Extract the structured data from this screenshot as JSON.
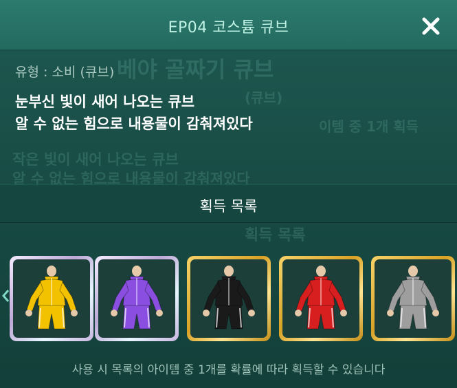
{
  "header": {
    "title": "EP04 코스튬 큐브",
    "close_icon": "close-icon"
  },
  "info": {
    "type_line": "유형 : 소비 (큐브)",
    "description": [
      "눈부신 빛이 새어 나오는 큐브",
      "알 수 없는 힘으로 내용물이 감춰져있다"
    ]
  },
  "reward_section": {
    "title": "획득 목록"
  },
  "items": [
    {
      "name": "yellow-tracksuit",
      "color": "#f2c200",
      "frame": "silver"
    },
    {
      "name": "purple-tracksuit",
      "color": "#8a4fe0",
      "frame": "silver"
    },
    {
      "name": "black-tracksuit",
      "color": "#1a1a1a",
      "frame": "gold"
    },
    {
      "name": "red-tracksuit",
      "color": "#d81f1f",
      "frame": "gold"
    },
    {
      "name": "gray-tracksuit",
      "color": "#9e9e9e",
      "frame": "gold"
    }
  ],
  "footer": {
    "note": "사용 시 목록의 아이템 중 1개를 확률에 따라 획득할 수 있습니다"
  }
}
